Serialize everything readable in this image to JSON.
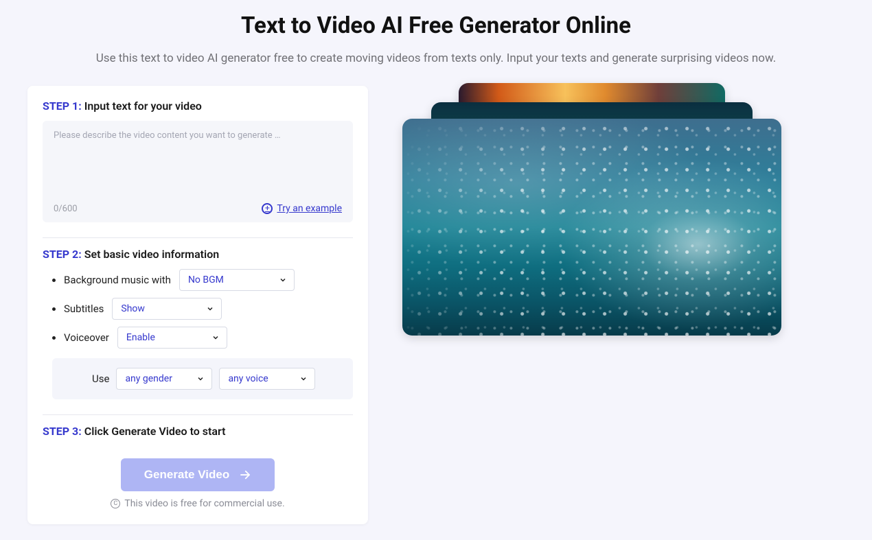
{
  "hero": {
    "title": "Text to Video AI Free Generator Online",
    "subtitle": "Use this text to video AI generator free to create moving videos from texts only. Input your texts and generate surprising videos now."
  },
  "step1": {
    "label": "STEP 1:",
    "title": "Input text for your video",
    "placeholder": "Please describe the video content you want to generate …",
    "counter": "0/600",
    "try_example": "Try an example"
  },
  "step2": {
    "label": "STEP 2:",
    "title": "Set basic video information",
    "bgm_label": "Background music with",
    "bgm_value": "No BGM",
    "subtitles_label": "Subtitles",
    "subtitles_value": "Show",
    "voiceover_label": "Voiceover",
    "voiceover_value": "Enable",
    "use_label": "Use",
    "gender_value": "any gender",
    "voice_value": "any voice"
  },
  "step3": {
    "label": "STEP 3:",
    "title": "Click Generate Video to start",
    "button": "Generate Video",
    "disclaimer": "This video is free for commercial use."
  }
}
